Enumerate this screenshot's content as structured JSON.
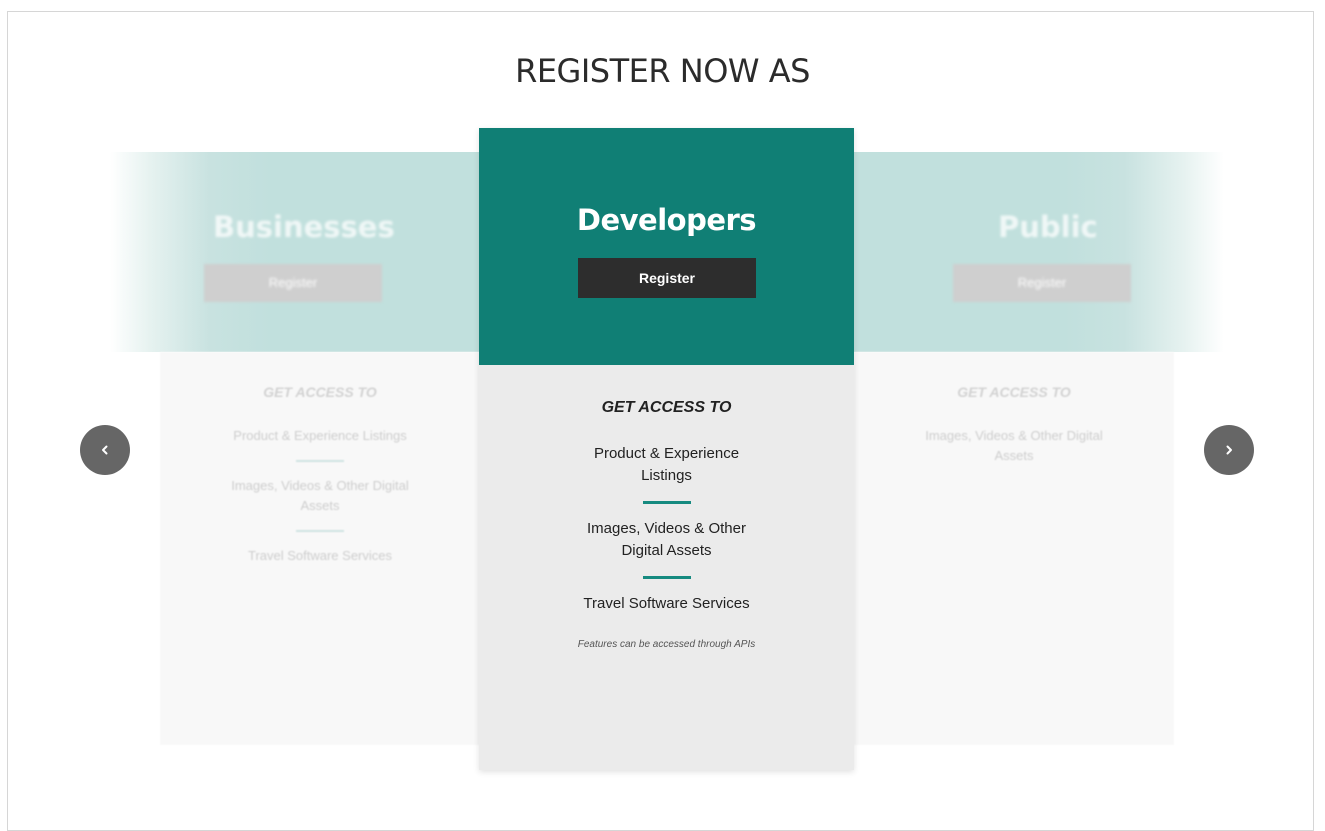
{
  "page": {
    "title": "REGISTER NOW AS"
  },
  "cards": {
    "left": {
      "title": "Businesses",
      "register_label": "Register",
      "access_heading": "GET ACCESS TO",
      "features": [
        "Product & Experience Listings",
        "Images, Videos & Other Digital Assets",
        "Travel Software Services"
      ]
    },
    "center": {
      "title": "Developers",
      "register_label": "Register",
      "access_heading": "GET ACCESS TO",
      "features": [
        "Product & Experience Listings",
        "Images, Videos & Other Digital Assets",
        "Travel Software Services"
      ],
      "note": "Features can be accessed through APIs"
    },
    "right": {
      "title": "Public",
      "register_label": "Register",
      "access_heading": "GET ACCESS TO",
      "features": [
        "Images, Videos & Other Digital Assets"
      ]
    }
  },
  "carousel": {
    "prev_icon": "chevron-left-icon",
    "next_icon": "chevron-right-icon"
  },
  "colors": {
    "accent": "#107f75",
    "divider": "#168a80",
    "button_dark": "#2d2d2d",
    "arrow_bg": "#666666"
  }
}
